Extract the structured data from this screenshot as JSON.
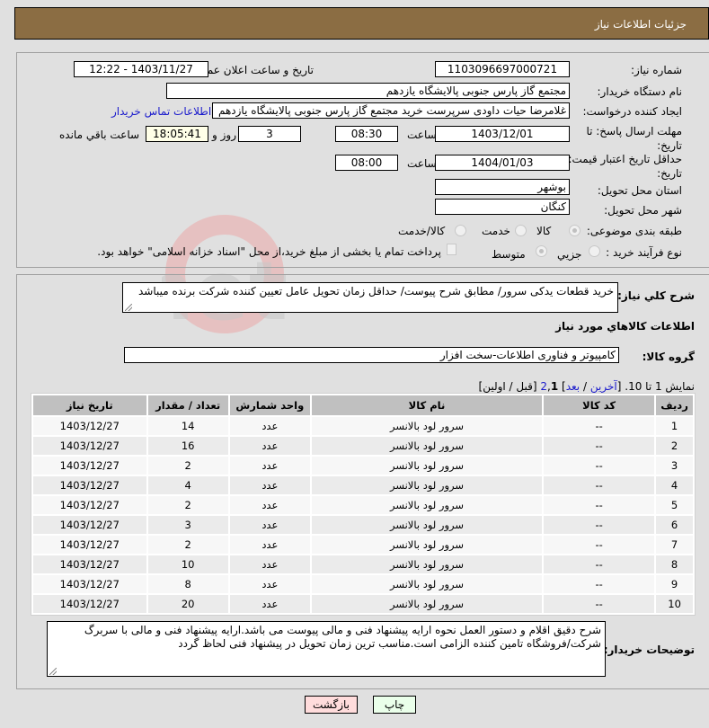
{
  "header": {
    "title": "جزئيات اطلاعات نياز"
  },
  "form": {
    "need_number_label": "شماره نياز:",
    "need_number": "1103096697000721",
    "announce_label": "تاريخ و ساعت اعلان عمومي:",
    "announce_value": "1403/11/27 - 12:22",
    "buyer_org_label": "نام دستگاه خريدار:",
    "buyer_org": "مجتمع گاز پارس جنوبی  پالایشگاه یازدهم",
    "creator_label": "ايجاد کننده درخواست:",
    "creator": "غلامرضا حیات داودی سرپرست خرید مجتمع گاز پارس جنوبی  پالایشگاه یازدهم",
    "buyer_contact_link": "اطلاعات تماس خريدار",
    "deadline_label": "مهلت ارسال پاسخ: تا تاريخ:",
    "deadline_date": "1403/12/01",
    "time_label": "ساعت",
    "deadline_time": "08:30",
    "days_value": "3",
    "days_label": "روز و",
    "remaining_time": "18:05:41",
    "remaining_label": "ساعت باقي مانده",
    "validity_label": "حداقل تاريخ اعتبار قيمت: تا تاريخ:",
    "validity_date": "1404/01/03",
    "validity_time": "08:00",
    "province_label": "استان محل تحويل:",
    "province": "بوشهر",
    "city_label": "شهر محل تحويل:",
    "city": "کنگان",
    "category_label": "طبقه بندی موضوعی:",
    "category_options": [
      "کالا",
      "خدمت",
      "کالا/خدمت"
    ],
    "category_selected": "کالا",
    "purchase_type_label": "نوع فرآيند خريد :",
    "purchase_type_options": [
      "جزيي",
      "متوسط"
    ],
    "purchase_type_selected": "متوسط",
    "payment_note": "پرداخت تمام يا بخشی از مبلغ خريد،از محل \"اسناد خزانه اسلامی\" خواهد بود."
  },
  "details": {
    "general_desc_label": "شرح کلي نياز:",
    "general_desc": "خرید قطعات یدکی سرور/ مطابق شرح پیوست/ حداقل زمان تحویل عامل تعیین کننده شرکت برنده میباشد",
    "goods_info_title": "اطلاعات کالاهاي مورد نياز",
    "goods_group_label": "گروه کالا:",
    "goods_group": "کامپیوتر و فناوری اطلاعات-سخت افزار"
  },
  "pagination": {
    "showing": "نمايش 1 تا 10.",
    "open_bracket": "[",
    "last": "آخرين",
    "sep": "/",
    "next": "بعد",
    "close_bracket": "]",
    "page2": "2",
    "page_sep": ",",
    "page1": "1",
    "prev_first": "[قبل / اولين]"
  },
  "table": {
    "headers": [
      "رديف",
      "کد کالا",
      "نام کالا",
      "واحد شمارش",
      "تعداد / مقدار",
      "تاريخ نياز"
    ],
    "rows": [
      [
        "1",
        "--",
        "سرور لود بالانسر",
        "عدد",
        "14",
        "1403/12/27"
      ],
      [
        "2",
        "--",
        "سرور لود بالانسر",
        "عدد",
        "16",
        "1403/12/27"
      ],
      [
        "3",
        "--",
        "سرور لود بالانسر",
        "عدد",
        "2",
        "1403/12/27"
      ],
      [
        "4",
        "--",
        "سرور لود بالانسر",
        "عدد",
        "4",
        "1403/12/27"
      ],
      [
        "5",
        "--",
        "سرور لود بالانسر",
        "عدد",
        "2",
        "1403/12/27"
      ],
      [
        "6",
        "--",
        "سرور لود بالانسر",
        "عدد",
        "3",
        "1403/12/27"
      ],
      [
        "7",
        "--",
        "سرور لود بالانسر",
        "عدد",
        "2",
        "1403/12/27"
      ],
      [
        "8",
        "--",
        "سرور لود بالانسر",
        "عدد",
        "10",
        "1403/12/27"
      ],
      [
        "9",
        "--",
        "سرور لود بالانسر",
        "عدد",
        "8",
        "1403/12/27"
      ],
      [
        "10",
        "--",
        "سرور لود بالانسر",
        "عدد",
        "20",
        "1403/12/27"
      ]
    ]
  },
  "buyer_notes": {
    "label": "توضيحات خريدار:",
    "text": "شرح دقیق اقلام و دستور العمل نحوه ارایه پیشنهاد فنی و مالی پیوست می باشد.ارایه پیشنهاد فنی و مالی با سربرگ شرکت/فروشگاه تامین کننده الزامی است.مناسب ترین زمان تحویل در پیشنهاد فنی لحاظ گردد"
  },
  "buttons": {
    "print": "چاپ",
    "back": "بازگشت"
  },
  "colors": {
    "header_bg": "#8b6d43",
    "print_bg": "#eaffea",
    "back_bg": "#ffdcdc",
    "link": "#1a1acc"
  }
}
